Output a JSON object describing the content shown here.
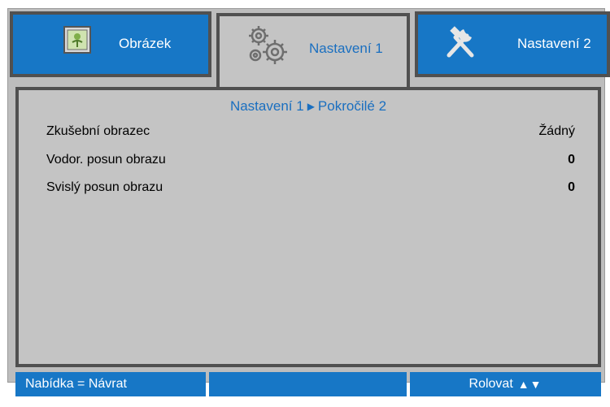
{
  "tabs": [
    {
      "label": "Obrázek",
      "icon": "picture-icon",
      "active": false
    },
    {
      "label": "Nastavení 1",
      "icon": "gears-icon",
      "active": true
    },
    {
      "label": "Nastavení 2",
      "icon": "tools-icon",
      "active": false
    }
  ],
  "breadcrumb": {
    "parent": "Nastavení 1",
    "arrow": "▶",
    "child": "Pokročilé 2"
  },
  "rows": [
    {
      "label": "Zkušební obrazec",
      "value": "Žádný"
    },
    {
      "label": "Vodor. posun obrazu",
      "value": "0"
    },
    {
      "label": "Svislý posun obrazu",
      "value": "0"
    }
  ],
  "footer": {
    "back": "Nabídka = Návrat",
    "middle": "",
    "scroll": "Rolovat",
    "scroll_arrows": "▲▼"
  },
  "colors": {
    "accent": "#1777c6",
    "panel": "#c4c4c4",
    "border": "#505050",
    "active_text": "#1a6fc0"
  }
}
